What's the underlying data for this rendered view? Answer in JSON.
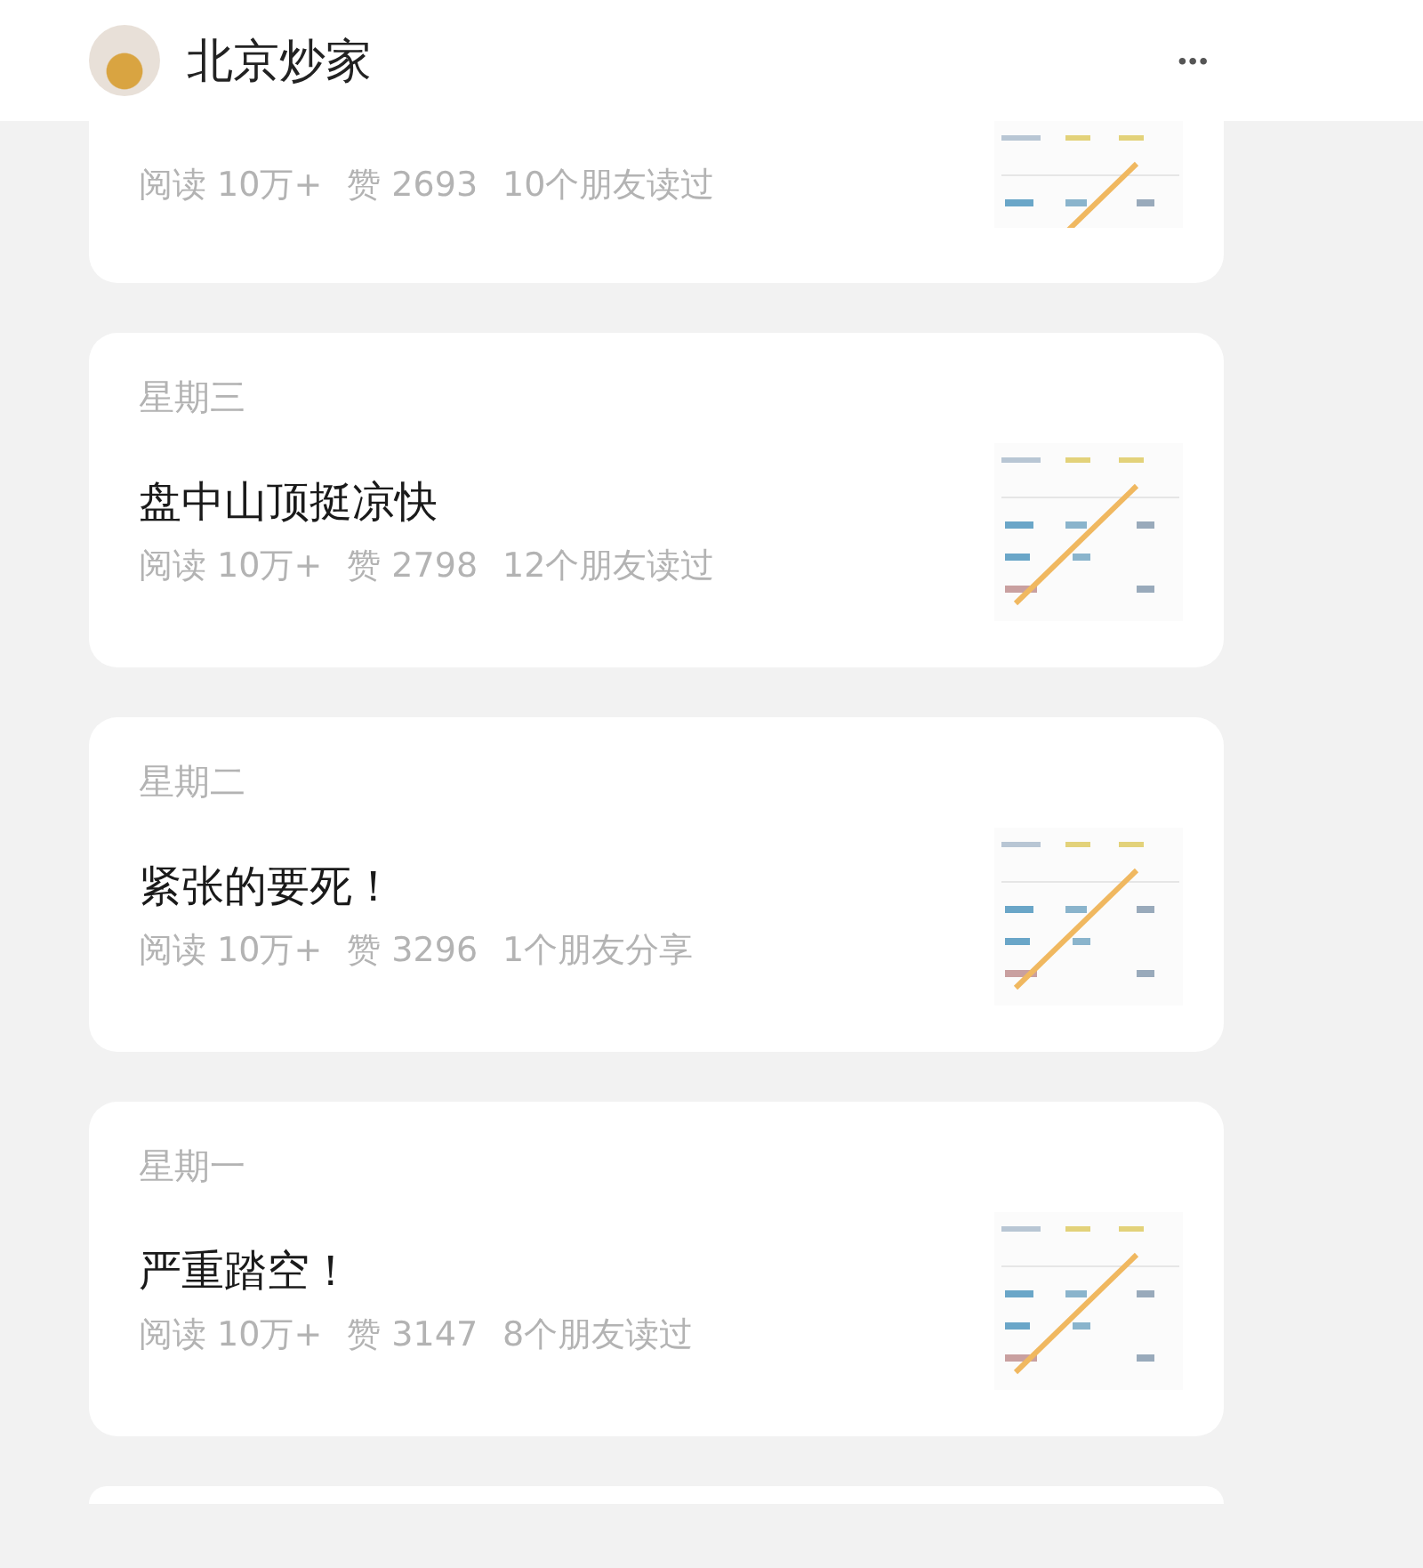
{
  "header": {
    "title": "北京炒家",
    "menu": "•••"
  },
  "articles": [
    {
      "kind": "cut-top",
      "reads": "阅读 10万+",
      "likes": "赞 2693",
      "social": "10个朋友读过"
    },
    {
      "kind": "full",
      "day": "星期三",
      "title": "盘中山顶挺凉快",
      "reads": "阅读 10万+",
      "likes": "赞 2798",
      "social": "12个朋友读过"
    },
    {
      "kind": "full",
      "day": "星期二",
      "title": "紧张的要死！",
      "reads": "阅读 10万+",
      "likes": "赞 3296",
      "social": "1个朋友分享"
    },
    {
      "kind": "full",
      "day": "星期一",
      "title": "严重踏空！",
      "reads": "阅读 10万+",
      "likes": "赞 3147",
      "social": "8个朋友读过"
    },
    {
      "kind": "cut-bottom"
    }
  ]
}
